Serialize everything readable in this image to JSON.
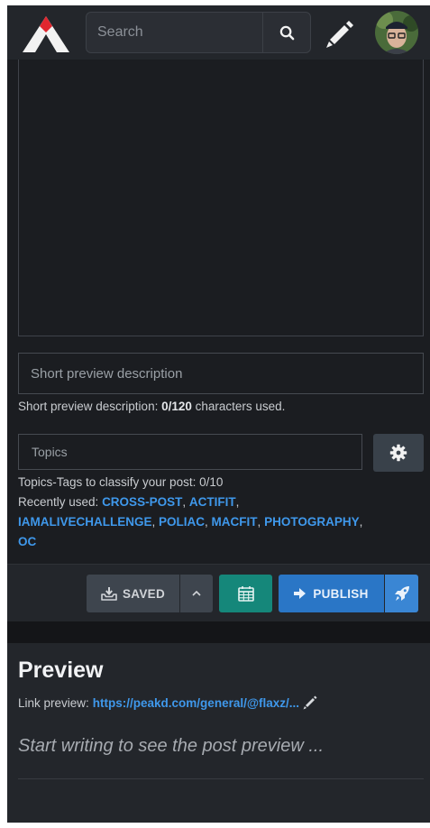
{
  "header": {
    "search_placeholder": "Search",
    "icons": {
      "logo": "peakd-logo",
      "search": "search-icon",
      "compose": "pencil-icon",
      "avatar": "user-avatar"
    }
  },
  "editor": {
    "description_placeholder": "Short preview description",
    "description_hint_prefix": "Short preview description: ",
    "description_count": "0/120",
    "description_hint_suffix": " characters used.",
    "topics_placeholder": "Topics",
    "topics_hint": "Topics-Tags to classify your post: 0/10",
    "recent_label": "Recently used: ",
    "recent_tags": [
      "CROSS-POST",
      "ACTIFIT",
      "IAMALIVECHALLENGE",
      "POLIAC",
      "MACFIT",
      "PHOTOGRAPHY",
      "OC"
    ]
  },
  "actions": {
    "saved_label": "SAVED",
    "publish_label": "PUBLISH"
  },
  "preview": {
    "title": "Preview",
    "link_label": "Link preview: ",
    "link_url": "https://peakd.com/general/@flaxz/...",
    "placeholder": "Start writing to see the post preview ..."
  },
  "colors": {
    "background": "#1b1d21",
    "panel": "#23262b",
    "accent_blue": "#2a76c6",
    "calendar_green": "#15877a",
    "link_blue": "#3f98eb",
    "logo_red": "#e0262f"
  }
}
